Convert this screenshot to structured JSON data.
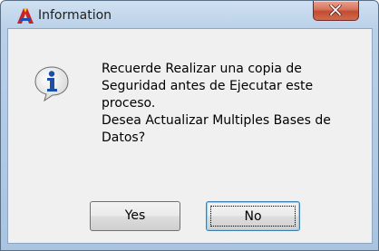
{
  "window": {
    "title": "Information",
    "app_icon": "app-logo-icon",
    "close_icon": "close-icon"
  },
  "dialog": {
    "icon": "info-icon",
    "message_lines": [
      "Recuerde Realizar una copia de",
      "Seguridad antes de Ejecutar este",
      "proceso.",
      "Desea Actualizar Multiples Bases de",
      "Datos?"
    ],
    "buttons": {
      "yes_label": "Yes",
      "no_label": "No"
    },
    "default_button": "No"
  },
  "colors": {
    "close_button": "#c44c30",
    "info_icon_blue": "#1b4fa8",
    "client_background": "#f0f0f0"
  }
}
